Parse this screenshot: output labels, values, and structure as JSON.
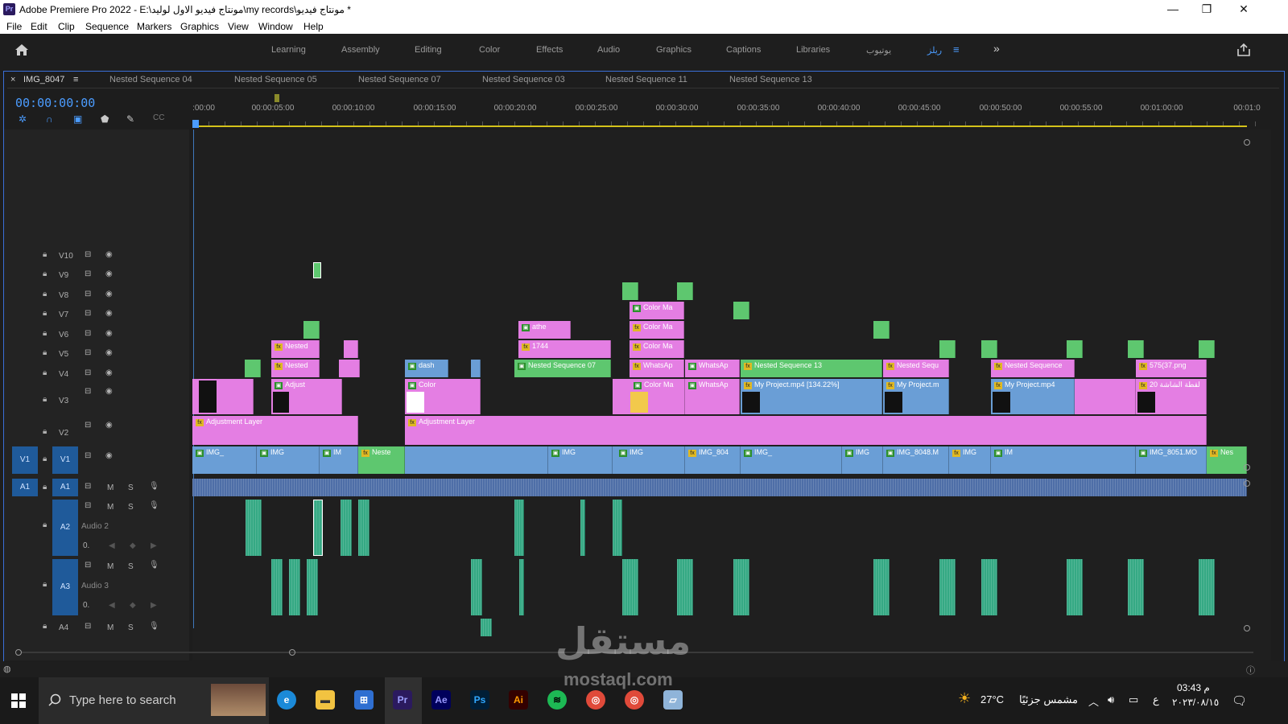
{
  "window": {
    "app_badge": "Pr",
    "title": "Adobe Premiere Pro 2022 - E:\\مونتاج فيديو الاول لوليد\\my records\\مونتاج فيديو *",
    "minimize": "—",
    "maximize": "❐",
    "close": "✕"
  },
  "menu": [
    "File",
    "Edit",
    "Clip",
    "Sequence",
    "Markers",
    "Graphics",
    "View",
    "Window",
    "Help"
  ],
  "workspaces": {
    "tabs": [
      "Learning",
      "Assembly",
      "Editing",
      "Color",
      "Effects",
      "Audio",
      "Graphics",
      "Captions",
      "Libraries",
      "يوتيوب",
      "ريلز"
    ],
    "active": "ريلز",
    "overflow": "»"
  },
  "sequence_tabs": {
    "close": "×",
    "active": "IMG_8047",
    "menu": "≡",
    "others": [
      "Nested Sequence 04",
      "Nested Sequence 05",
      "Nested Sequence 07",
      "Nested Sequence 03",
      "Nested Sequence 11",
      "Nested Sequence 13"
    ]
  },
  "timeline": {
    "timecode": "00:00:00:00",
    "ruler_labels": [
      ":00:00",
      "00:00:05:00",
      "00:00:10:00",
      "00:00:15:00",
      "00:00:20:00",
      "00:00:25:00",
      "00:00:30:00",
      "00:00:35:00",
      "00:00:40:00",
      "00:00:45:00",
      "00:00:50:00",
      "00:00:55:00",
      "00:01:00:00",
      "00:01:0"
    ]
  },
  "tracks": {
    "video": [
      "V10",
      "V9",
      "V8",
      "V7",
      "V6",
      "V5",
      "V4",
      "V3",
      "V2",
      "V1"
    ],
    "source_video": "V1",
    "source_audio": "A1",
    "audio": [
      "A1",
      "A2",
      "A3",
      "A4"
    ],
    "a2_name": "Audio 2",
    "a3_name": "Audio 3",
    "mute": "M",
    "solo": "S",
    "volume": "0."
  },
  "clips": {
    "v7_color1": "Color Ma",
    "v6_athe": "athe",
    "v6_color": "Color Ma",
    "v5_nested": "Nested",
    "v5_1744": "1744",
    "v5_color": "Color Ma",
    "v4_nested": "Nested",
    "v4_dash": "dash",
    "v4_nested07": "Nested Sequence 07",
    "v4_whatsapp1": "WhatsAp",
    "v4_whatsapp2": "WhatsAp",
    "v4_nested13": "Nested Sequence 13",
    "v4_nestedsequ": "Nested Sequ",
    "v4_nestedsequence": "Nested Sequence",
    "v4_png": "575(37.png",
    "v3_adjust": "Adjust",
    "v3_color1": "Color",
    "v3_colorma": "Color Ma",
    "v3_whatsapp": "WhatsAp",
    "v3_myproject1": "My Project.mp4 [134.22%]",
    "v3_myproject2": "My Project.m",
    "v3_myproject3": "My Project.mp4",
    "v3_arabic": "لقطة الشاشة 20",
    "v2_adj1": "Adjustment Layer",
    "v2_adj2": "Adjustment Layer",
    "v1_img1": "IMG_",
    "v1_img2": "IMG",
    "v1_im": "IM",
    "v1_neste": "Neste",
    "v1_img3": "IMG",
    "v1_img4": "IMG",
    "v1_img804": "IMG_804",
    "v1_img5": "IMG_",
    "v1_img6": "IMG",
    "v1_img8048": "IMG_8048.M",
    "v1_img7": "IMG",
    "v1_im2": "IM",
    "v1_img8051": "IMG_8051.MO",
    "v1_nes": "Nes"
  },
  "taskbar": {
    "search_placeholder": "Type here to search",
    "apps": [
      "Pr",
      "Ae",
      "Ps",
      "Ai"
    ],
    "temperature": "27°C",
    "weather": "مشمس جزئيًا",
    "lang": "ع",
    "time": "03:43 م",
    "date": "٢٠٢٣/٠٨/١٥"
  },
  "watermark": {
    "arabic": "مستقل",
    "latin": "mostaql.com"
  },
  "colors": {
    "accent": "#4b9cff",
    "video_pink": "#e47ee3",
    "video_blue": "#6a9ed6",
    "video_green": "#5ec76f",
    "audio_teal": "#35a984",
    "audio_blue": "#4e6ea7",
    "track_target": "#1f5a9a"
  }
}
